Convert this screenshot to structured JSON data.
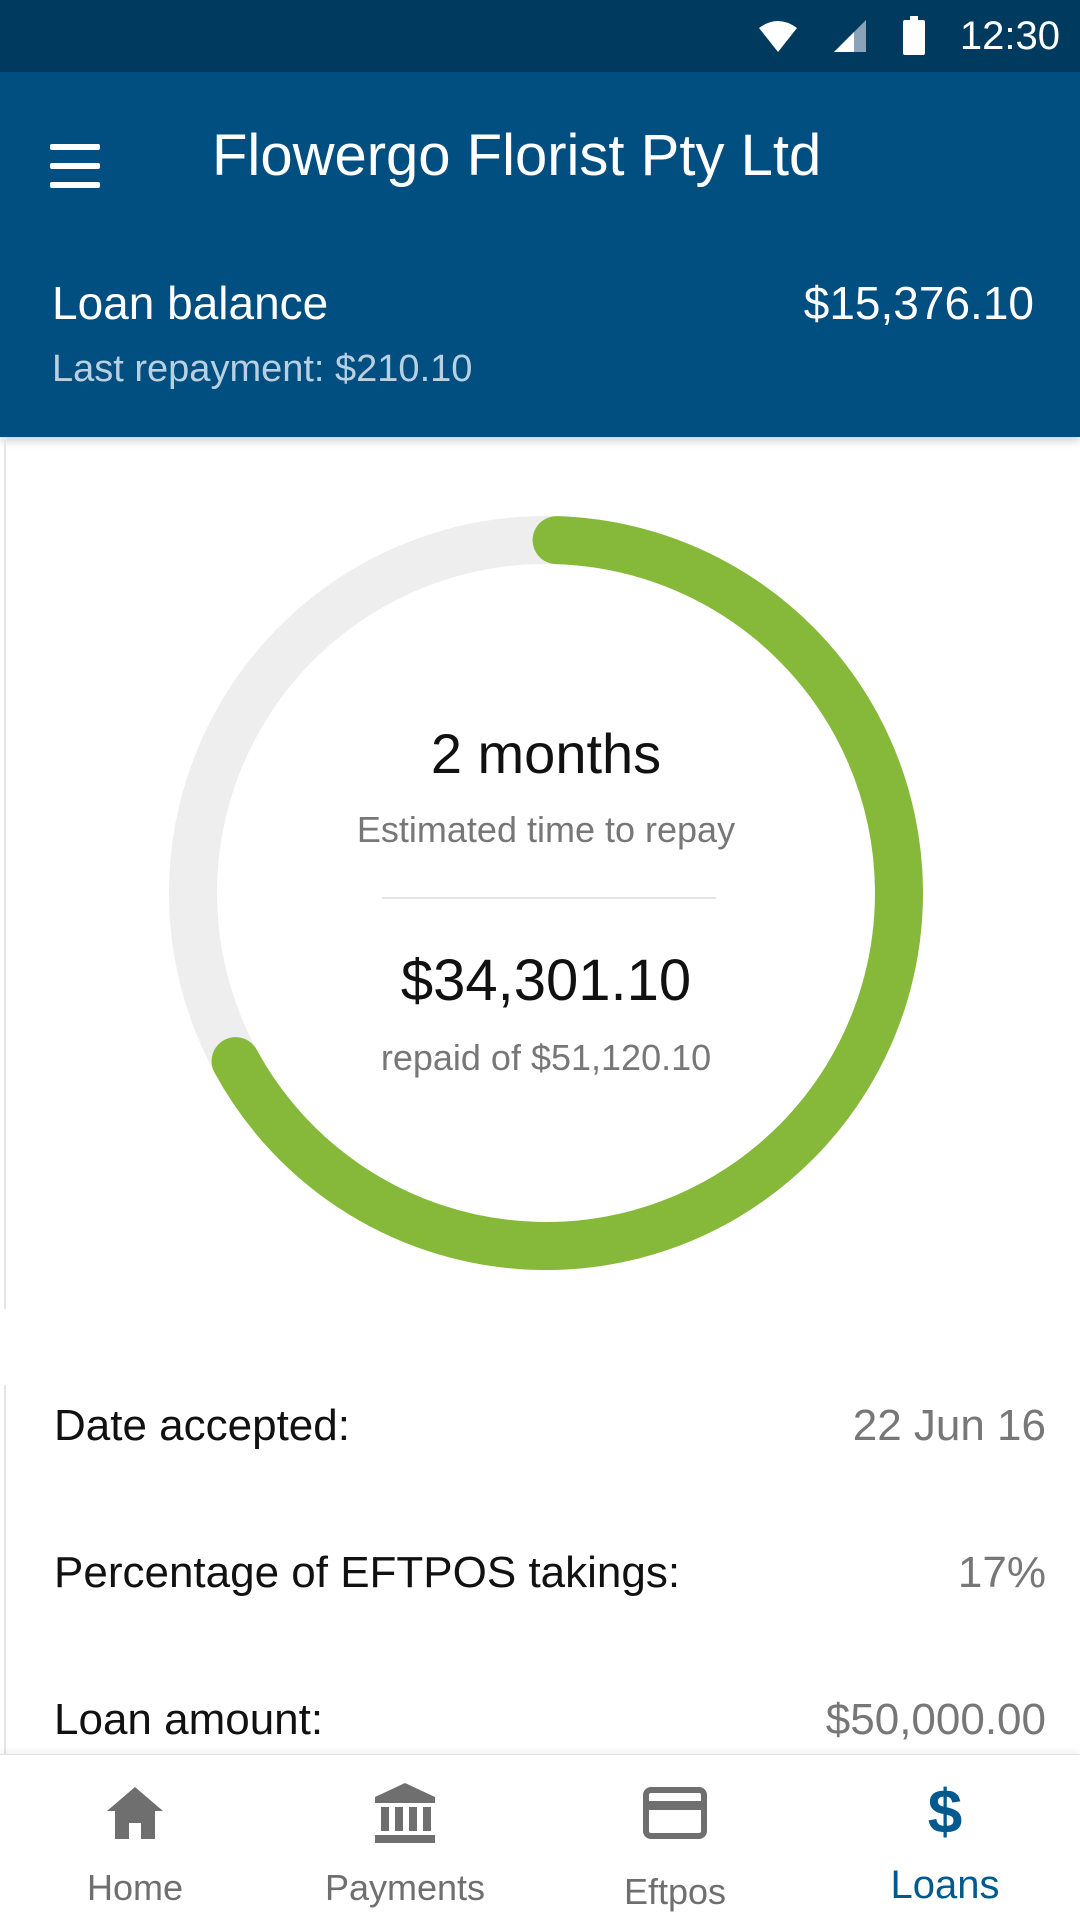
{
  "status_bar": {
    "time": "12:30"
  },
  "app_bar": {
    "title": "Flowergo Florist Pty Ltd"
  },
  "summary": {
    "balance_label": "Loan balance",
    "balance_value": "$15,376.10",
    "last_repayment": "Last repayment: $210.10"
  },
  "progress": {
    "repaid_fraction": 0.671,
    "time_to_repay": "2 months",
    "time_to_repay_label": "Estimated time to repay",
    "repaid_amount": "$34,301.10",
    "repaid_of_label": "repaid of $51,120.10"
  },
  "details": [
    {
      "label": "Date accepted:",
      "value": "22 Jun 16"
    },
    {
      "label": "Percentage of EFTPOS takings:",
      "value": "17%"
    },
    {
      "label": "Loan amount:",
      "value": "$50,000.00"
    }
  ],
  "bottom_nav": [
    {
      "label": "Home",
      "icon": "home-icon",
      "active": false
    },
    {
      "label": "Payments",
      "icon": "bank-icon",
      "active": false
    },
    {
      "label": "Eftpos",
      "icon": "card-icon",
      "active": false
    },
    {
      "label": "Loans",
      "icon": "dollar-icon",
      "active": true
    }
  ],
  "colors": {
    "status_bar": "#003a5f",
    "app_bar": "#004f80",
    "progress_fill": "#86b93a",
    "progress_track": "#eeeeee",
    "active_nav": "#005a8e",
    "inactive_nav": "#6f6f6f"
  }
}
